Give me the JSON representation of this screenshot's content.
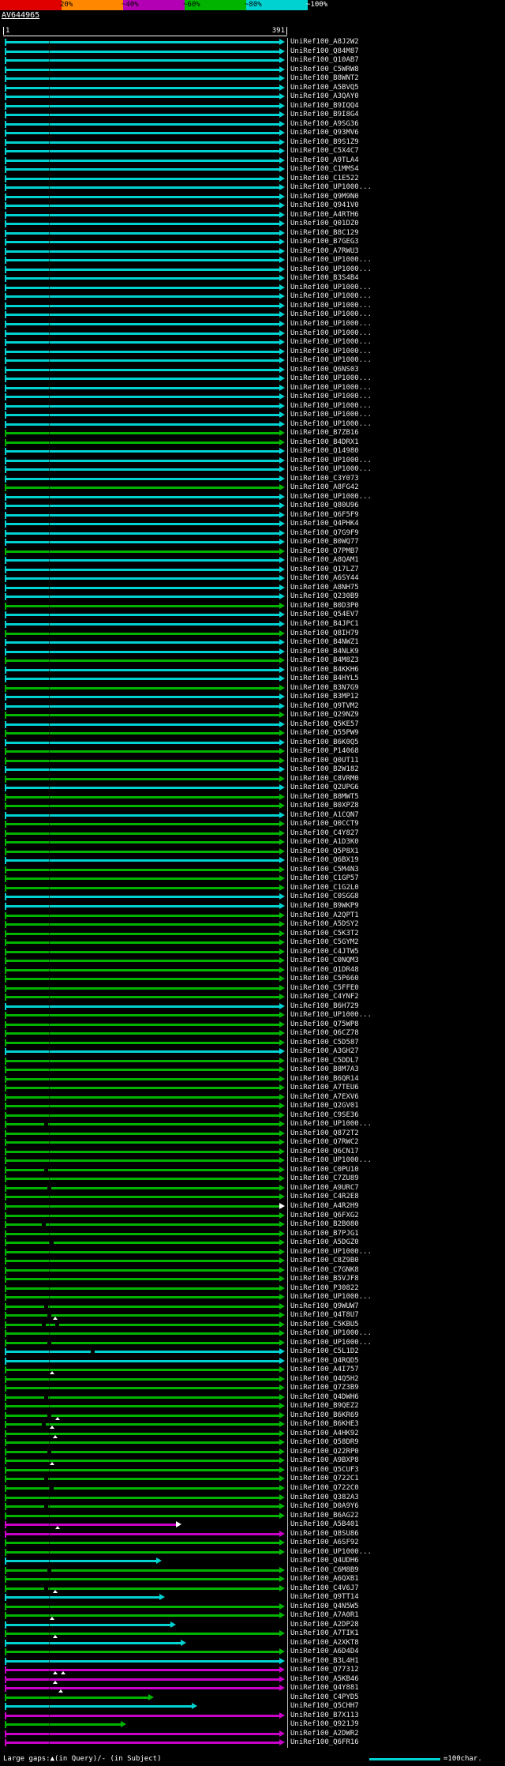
{
  "chart_data": {
    "type": "bar",
    "query_name": "AV644965",
    "x_axis": {
      "start": 1,
      "end": 391
    },
    "identity_scale": {
      "segments": [
        {
          "range": "<20%",
          "color": "#e00000"
        },
        {
          "range": "20-40%",
          "color": "#ff8700"
        },
        {
          "range": "40-60%",
          "color": "#b400b4"
        },
        {
          "range": "60-80%",
          "color": "#00b400"
        },
        {
          "range": "80-100%",
          "color": "#00d2d2"
        }
      ],
      "tick_labels": [
        "20%",
        "~40%",
        "~60%",
        "~80%",
        "~100%"
      ]
    },
    "colors": {
      "cyan": "#00d2d2",
      "green": "#00b400",
      "magenta": "#c800c8"
    },
    "unit_scale_label": "=100char.",
    "gaps_note": "Large gaps:▲(in Query)/- (in Subject)",
    "hits": [
      {
        "label": "UniRef100_A8J2W2",
        "color": "cyan"
      },
      {
        "label": "UniRef100_Q84M87",
        "color": "cyan"
      },
      {
        "label": "UniRef100_Q10AB7",
        "color": "cyan"
      },
      {
        "label": "UniRef100_C5WRW8",
        "color": "cyan"
      },
      {
        "label": "UniRef100_B8WNT2",
        "color": "cyan"
      },
      {
        "label": "UniRef100_A5BVQ5",
        "color": "cyan"
      },
      {
        "label": "UniRef100_A3QAY0",
        "color": "cyan"
      },
      {
        "label": "UniRef100_B9IQQ4",
        "color": "cyan"
      },
      {
        "label": "UniRef100_B9I8G4",
        "color": "cyan"
      },
      {
        "label": "UniRef100_A9SG36",
        "color": "cyan"
      },
      {
        "label": "UniRef100_Q93MV6",
        "color": "cyan"
      },
      {
        "label": "UniRef100_B9S1Z9",
        "color": "cyan"
      },
      {
        "label": "UniRef100_C5X4C7",
        "color": "cyan"
      },
      {
        "label": "UniRef100_A9TLA4",
        "color": "cyan"
      },
      {
        "label": "UniRef100_C1MMS4",
        "color": "cyan"
      },
      {
        "label": "UniRef100_C1E522",
        "color": "cyan"
      },
      {
        "label": "UniRef100_UP1000...",
        "color": "cyan"
      },
      {
        "label": "UniRef100_Q9M9N0",
        "color": "cyan"
      },
      {
        "label": "UniRef100_Q941V0",
        "color": "cyan"
      },
      {
        "label": "UniRef100_A4RTH6",
        "color": "cyan"
      },
      {
        "label": "UniRef100_Q01DZ0",
        "color": "cyan"
      },
      {
        "label": "UniRef100_B8C129",
        "color": "cyan"
      },
      {
        "label": "UniRef100_B7GEG3",
        "color": "cyan"
      },
      {
        "label": "UniRef100_A7RWU3",
        "color": "cyan"
      },
      {
        "label": "UniRef100_UP1000...",
        "color": "cyan"
      },
      {
        "label": "UniRef100_UP1000...",
        "color": "cyan"
      },
      {
        "label": "UniRef100_B3S4B4",
        "color": "cyan"
      },
      {
        "label": "UniRef100_UP1000...",
        "color": "cyan"
      },
      {
        "label": "UniRef100_UP1000...",
        "color": "cyan"
      },
      {
        "label": "UniRef100_UP1000...",
        "color": "cyan"
      },
      {
        "label": "UniRef100_UP1000...",
        "color": "cyan"
      },
      {
        "label": "UniRef100_UP1000...",
        "color": "cyan"
      },
      {
        "label": "UniRef100_UP1000...",
        "color": "cyan"
      },
      {
        "label": "UniRef100_UP1000...",
        "color": "cyan"
      },
      {
        "label": "UniRef100_UP1000...",
        "color": "cyan"
      },
      {
        "label": "UniRef100_UP1000...",
        "color": "cyan"
      },
      {
        "label": "UniRef100_Q6NS03",
        "color": "cyan"
      },
      {
        "label": "UniRef100_UP1000...",
        "color": "cyan"
      },
      {
        "label": "UniRef100_UP1000...",
        "color": "cyan"
      },
      {
        "label": "UniRef100_UP1000...",
        "color": "cyan"
      },
      {
        "label": "UniRef100_UP1000...",
        "color": "cyan"
      },
      {
        "label": "UniRef100_UP1000...",
        "color": "cyan"
      },
      {
        "label": "UniRef100_UP1000...",
        "color": "cyan"
      },
      {
        "label": "UniRef100_B7ZB16",
        "color": "green"
      },
      {
        "label": "UniRef100_B4DRX1",
        "color": "green"
      },
      {
        "label": "UniRef100_Q14980",
        "color": "cyan"
      },
      {
        "label": "UniRef100_UP1000...",
        "color": "cyan"
      },
      {
        "label": "UniRef100_UP1000...",
        "color": "cyan"
      },
      {
        "label": "UniRef100_C3Y073",
        "color": "cyan"
      },
      {
        "label": "UniRef100_A8FG42",
        "color": "green"
      },
      {
        "label": "UniRef100_UP1000...",
        "color": "cyan"
      },
      {
        "label": "UniRef100_Q80U96",
        "color": "cyan"
      },
      {
        "label": "UniRef100_Q6F5F9",
        "color": "cyan"
      },
      {
        "label": "UniRef100_Q4PHK4",
        "color": "cyan"
      },
      {
        "label": "UniRef100_Q7G9F9",
        "color": "cyan"
      },
      {
        "label": "UniRef100_B0WQ77",
        "color": "cyan"
      },
      {
        "label": "UniRef100_Q7PMB7",
        "color": "green"
      },
      {
        "label": "UniRef100_A8QAM1",
        "color": "cyan"
      },
      {
        "label": "UniRef100_Q17LZ7",
        "color": "cyan"
      },
      {
        "label": "UniRef100_A6SY44",
        "color": "cyan"
      },
      {
        "label": "UniRef100_A8NH75",
        "color": "cyan"
      },
      {
        "label": "UniRef100_Q230B9",
        "color": "cyan"
      },
      {
        "label": "UniRef100_B0D3P0",
        "color": "green"
      },
      {
        "label": "UniRef100_Q54EV7",
        "color": "cyan"
      },
      {
        "label": "UniRef100_B4JPC1",
        "color": "cyan"
      },
      {
        "label": "UniRef100_Q8IH79",
        "color": "green"
      },
      {
        "label": "UniRef100_B4NWZ1",
        "color": "cyan"
      },
      {
        "label": "UniRef100_B4NLK9",
        "color": "cyan"
      },
      {
        "label": "UniRef100_B4M8Z3",
        "color": "green"
      },
      {
        "label": "UniRef100_B4KKH6",
        "color": "cyan"
      },
      {
        "label": "UniRef100_B4HYL5",
        "color": "cyan"
      },
      {
        "label": "UniRef100_B3N7G9",
        "color": "green"
      },
      {
        "label": "UniRef100_B3MP12",
        "color": "cyan"
      },
      {
        "label": "UniRef100_Q9TVM2",
        "color": "cyan"
      },
      {
        "label": "UniRef100_Q29NZ9",
        "color": "green"
      },
      {
        "label": "UniRef100_Q5KE57",
        "color": "cyan"
      },
      {
        "label": "UniRef100_Q55PW9",
        "color": "green"
      },
      {
        "label": "UniRef100_B6K0Q5",
        "color": "cyan"
      },
      {
        "label": "UniRef100_P14068",
        "color": "green"
      },
      {
        "label": "UniRef100_Q0UT11",
        "color": "green"
      },
      {
        "label": "UniRef100_B2W182",
        "color": "cyan"
      },
      {
        "label": "UniRef100_C8VRM0",
        "color": "green"
      },
      {
        "label": "UniRef100_Q2UPG6",
        "color": "cyan"
      },
      {
        "label": "UniRef100_B8MWT5",
        "color": "green"
      },
      {
        "label": "UniRef100_B0XPZ8",
        "color": "green"
      },
      {
        "label": "UniRef100_A1CQN7",
        "color": "cyan"
      },
      {
        "label": "UniRef100_Q0CCT9",
        "color": "green"
      },
      {
        "label": "UniRef100_C4Y827",
        "color": "green"
      },
      {
        "label": "UniRef100_A1D3K0",
        "color": "green"
      },
      {
        "label": "UniRef100_Q5P8X1",
        "color": "green"
      },
      {
        "label": "UniRef100_Q6BX19",
        "color": "cyan"
      },
      {
        "label": "UniRef100_C5M4N3",
        "color": "green"
      },
      {
        "label": "UniRef100_C1GP57",
        "color": "green"
      },
      {
        "label": "UniRef100_C1G2L0",
        "color": "green"
      },
      {
        "label": "UniRef100_C0SGG8",
        "color": "cyan"
      },
      {
        "label": "UniRef100_B9WKP9",
        "color": "cyan"
      },
      {
        "label": "UniRef100_A2QPT1",
        "color": "green"
      },
      {
        "label": "UniRef100_A5DSY2",
        "color": "green"
      },
      {
        "label": "UniRef100_C5K3T2",
        "color": "green"
      },
      {
        "label": "UniRef100_C5GYM2",
        "color": "green"
      },
      {
        "label": "UniRef100_C4JTW5",
        "color": "green"
      },
      {
        "label": "UniRef100_C0NQM3",
        "color": "green"
      },
      {
        "label": "UniRef100_Q1DR48",
        "color": "green"
      },
      {
        "label": "UniRef100_C5P660",
        "color": "green"
      },
      {
        "label": "UniRef100_C5FFE0",
        "color": "green"
      },
      {
        "label": "UniRef100_C4YNF2",
        "color": "green"
      },
      {
        "label": "UniRef100_B6H729",
        "color": "cyan"
      },
      {
        "label": "UniRef100_UP1000...",
        "color": "green"
      },
      {
        "label": "UniRef100_Q75WP8",
        "color": "green"
      },
      {
        "label": "UniRef100_Q6CZ78",
        "color": "green"
      },
      {
        "label": "UniRef100_C5D587",
        "color": "green"
      },
      {
        "label": "UniRef100_A3GH27",
        "color": "cyan"
      },
      {
        "label": "UniRef100_C5DDL7",
        "color": "green"
      },
      {
        "label": "UniRef100_B8M7A3",
        "color": "green"
      },
      {
        "label": "UniRef100_B6QR14",
        "color": "green"
      },
      {
        "label": "UniRef100_A7TEU6",
        "color": "green"
      },
      {
        "label": "UniRef100_A7EXV6",
        "color": "green"
      },
      {
        "label": "UniRef100_Q2GV01",
        "color": "green"
      },
      {
        "label": "UniRef100_C9SE36",
        "color": "green"
      },
      {
        "label": "UniRef100_UP1000...",
        "color": "green",
        "gaps": [
          14
        ]
      },
      {
        "label": "UniRef100_Q872T2",
        "color": "green"
      },
      {
        "label": "UniRef100_Q7RWC2",
        "color": "green"
      },
      {
        "label": "UniRef100_Q6CN17",
        "color": "green"
      },
      {
        "label": "UniRef100_UP1000...",
        "color": "green"
      },
      {
        "label": "UniRef100_C0PU10",
        "color": "green",
        "gaps": [
          14
        ]
      },
      {
        "label": "UniRef100_C7ZU89",
        "color": "green"
      },
      {
        "label": "UniRef100_A9URC7",
        "color": "green",
        "gaps": [
          15
        ]
      },
      {
        "label": "UniRef100_C4R2E8",
        "color": "green"
      },
      {
        "label": "UniRef100_A4R2H9",
        "color": "green",
        "hollow": true
      },
      {
        "label": "UniRef100_Q6FXG2",
        "color": "green"
      },
      {
        "label": "UniRef100_B2B080",
        "color": "green",
        "gaps": [
          13
        ]
      },
      {
        "label": "UniRef100_B7PJG1",
        "color": "green"
      },
      {
        "label": "UniRef100_A5DGZ0",
        "color": "green",
        "gaps": [
          16
        ]
      },
      {
        "label": "UniRef100_UP1000...",
        "color": "green"
      },
      {
        "label": "UniRef100_C8Z9B0",
        "color": "green"
      },
      {
        "label": "UniRef100_C7GNK8",
        "color": "green"
      },
      {
        "label": "UniRef100_B5VJF8",
        "color": "green"
      },
      {
        "label": "UniRef100_P30822",
        "color": "green"
      },
      {
        "label": "UniRef100_UP1000...",
        "color": "green"
      },
      {
        "label": "UniRef100_Q9WUW7",
        "color": "green",
        "gaps": [
          14
        ]
      },
      {
        "label": "UniRef100_Q4T8U7",
        "color": "green",
        "gaps": [
          15
        ],
        "marks": [
          17
        ]
      },
      {
        "label": "UniRef100_C5KBU5",
        "color": "green",
        "gaps": [
          13,
          18
        ]
      },
      {
        "label": "UniRef100_UP1000...",
        "color": "green"
      },
      {
        "label": "UniRef100_UP1000...",
        "color": "green",
        "gaps": [
          15
        ]
      },
      {
        "label": "UniRef100_C5L1D2",
        "color": "cyan",
        "gaps": [
          31
        ]
      },
      {
        "label": "UniRef100_Q4RQD5",
        "color": "cyan"
      },
      {
        "label": "UniRef100_A4I757",
        "color": "green",
        "marks": [
          16
        ]
      },
      {
        "label": "UniRef100_Q4Q5H2",
        "color": "green"
      },
      {
        "label": "UniRef100_Q7Z3B9",
        "color": "green"
      },
      {
        "label": "UniRef100_Q4DWH6",
        "color": "green",
        "gaps": [
          14
        ]
      },
      {
        "label": "UniRef100_B9QEZ2",
        "color": "green"
      },
      {
        "label": "UniRef100_B6KR69",
        "color": "green",
        "gaps": [
          15
        ],
        "marks": [
          18
        ]
      },
      {
        "label": "UniRef100_B6KHE3",
        "color": "green",
        "gaps": [
          13
        ],
        "marks": [
          16
        ]
      },
      {
        "label": "UniRef100_A4HK92",
        "color": "green",
        "marks": [
          17
        ]
      },
      {
        "label": "UniRef100_Q58DR9",
        "color": "green"
      },
      {
        "label": "UniRef100_Q22RP0",
        "color": "green",
        "gaps": [
          15
        ]
      },
      {
        "label": "UniRef100_A9BXP8",
        "color": "green",
        "marks": [
          16
        ]
      },
      {
        "label": "UniRef100_Q5CUF3",
        "color": "green"
      },
      {
        "label": "UniRef100_Q722C1",
        "color": "green",
        "gaps": [
          14
        ]
      },
      {
        "label": "UniRef100_Q722C0",
        "color": "green",
        "gaps": [
          16
        ]
      },
      {
        "label": "UniRef100_Q382A3",
        "color": "green"
      },
      {
        "label": "UniRef100_D0A9Y6",
        "color": "green",
        "gaps": [
          14
        ]
      },
      {
        "label": "UniRef100_B6AG22",
        "color": "green"
      },
      {
        "label": "UniRef100_A5B401",
        "color": "magenta",
        "end": 62,
        "hollow": true,
        "marks": [
          18
        ]
      },
      {
        "label": "UniRef100_Q8SU86",
        "color": "magenta"
      },
      {
        "label": "UniRef100_A6SF92",
        "color": "green"
      },
      {
        "label": "UniRef100_UP1000...",
        "color": "green"
      },
      {
        "label": "UniRef100_Q4UDH6",
        "color": "cyan",
        "end": 55
      },
      {
        "label": "UniRef100_C6M8B9",
        "color": "green",
        "gaps": [
          15
        ]
      },
      {
        "label": "UniRef100_A6QXB1",
        "color": "green"
      },
      {
        "label": "UniRef100_C4V6J7",
        "color": "green",
        "gaps": [
          14
        ],
        "marks": [
          17
        ]
      },
      {
        "label": "UniRef100_Q9TT14",
        "color": "cyan",
        "end": 56
      },
      {
        "label": "UniRef100_Q4N5W5",
        "color": "green"
      },
      {
        "label": "UniRef100_A7A0R1",
        "color": "green",
        "marks": [
          16
        ]
      },
      {
        "label": "UniRef100_A2DP28",
        "color": "cyan",
        "end": 60
      },
      {
        "label": "UniRef100_A7TIK1",
        "color": "green",
        "marks": [
          17
        ]
      },
      {
        "label": "UniRef100_A2XKT8",
        "color": "cyan",
        "end": 64
      },
      {
        "label": "UniRef100_A6D4D4",
        "color": "green"
      },
      {
        "label": "UniRef100_B3L4H1",
        "color": "cyan"
      },
      {
        "label": "UniRef100_Q77312",
        "color": "magenta",
        "marks": [
          17,
          20
        ]
      },
      {
        "label": "UniRef100_A5KB46",
        "color": "magenta",
        "marks": [
          17
        ]
      },
      {
        "label": "UniRef100_Q4Y881",
        "color": "magenta",
        "marks": [
          19
        ]
      },
      {
        "label": "UniRef100_C4PYD5",
        "color": "green",
        "end": 52
      },
      {
        "label": "UniRef100_Q5CHH7",
        "color": "cyan",
        "end": 68
      },
      {
        "label": "UniRef100_B7X113",
        "color": "magenta"
      },
      {
        "label": "UniRef100_Q921J9",
        "color": "green",
        "end": 42
      },
      {
        "label": "UniRef100_A2DWR2",
        "color": "magenta"
      },
      {
        "label": "UniRef100_Q6FR16",
        "color": "magenta"
      }
    ]
  }
}
